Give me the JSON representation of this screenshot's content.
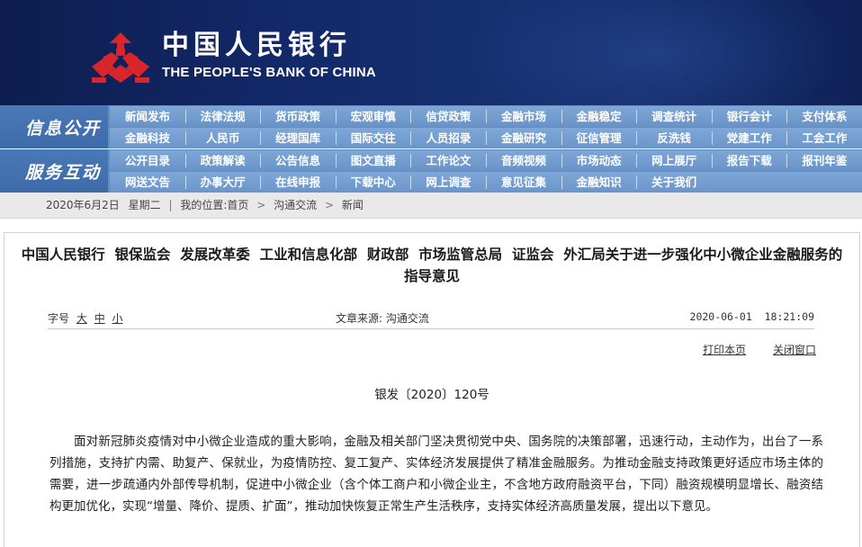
{
  "header": {
    "logo_cn": "中国人民银行",
    "logo_en": "THE PEOPLE'S BANK OF CHINA",
    "colors": {
      "banner": "#13296a",
      "emblem": "#d9262a",
      "nav": "#6993c8"
    }
  },
  "nav": {
    "info_title": "信息公开",
    "service_title": "服务互动",
    "info_row1": [
      "新闻发布",
      "法律法规",
      "货币政策",
      "宏观审慎",
      "信贷政策",
      "金融市场",
      "金融稳定",
      "调查统计",
      "银行会计",
      "支付体系"
    ],
    "info_row2": [
      "金融科技",
      "人民币",
      "经理国库",
      "国际交往",
      "人员招录",
      "金融研究",
      "征信管理",
      "反洗钱",
      "党建工作",
      "工会工作"
    ],
    "service_row1": [
      "公开目录",
      "政策解读",
      "公告信息",
      "图文直播",
      "工作论文",
      "音频视频",
      "市场动态",
      "网上展厅",
      "报告下载",
      "报刊年鉴"
    ],
    "service_row2": [
      "网送文告",
      "办事大厅",
      "在线申报",
      "下载中心",
      "网上调查",
      "意见征集",
      "金融知识",
      "关于我们"
    ]
  },
  "breadcrumb": {
    "date": "2020年6月2日",
    "weekday": "星期二",
    "location_label": "我的位置:",
    "items": [
      "首页",
      "沟通交流",
      "新闻"
    ]
  },
  "article": {
    "title_line1": "中国人民银行  银保监会  发展改革委  工业和信息化部  财政部  市场监管总局  证监会  外汇局关于进一步强化中小微企业金融服务的",
    "title_line2": "指导意见",
    "font_size_label": "字号",
    "font_large": "大",
    "font_medium": "中",
    "font_small": "小",
    "source": "文章来源: 沟通交流",
    "datetime": "2020-06-01  18:21:09",
    "print_label": "打印本页",
    "close_label": "关闭窗口",
    "doc_number": "银发〔2020〕120号",
    "paragraph1": "面对新冠肺炎疫情对中小微企业造成的重大影响，金融及相关部门坚决贯彻党中央、国务院的决策部署，迅速行动，主动作为，出台了一系列措施，支持扩内需、助复产、保就业，为疫情防控、复工复产、实体经济发展提供了精准金融服务。为推动金融支持政策更好适应市场主体的需要，进一步疏通内外部传导机制，促进中小微企业（含个体工商户和小微企业主，不含地方政府融资平台，下同）融资规模明显增长、融资结构更加优化，实现“增量、降价、提质、扩面”，推动加快恢复正常生产生活秩序，支持实体经济高质量发展，提出以下意见。"
  }
}
